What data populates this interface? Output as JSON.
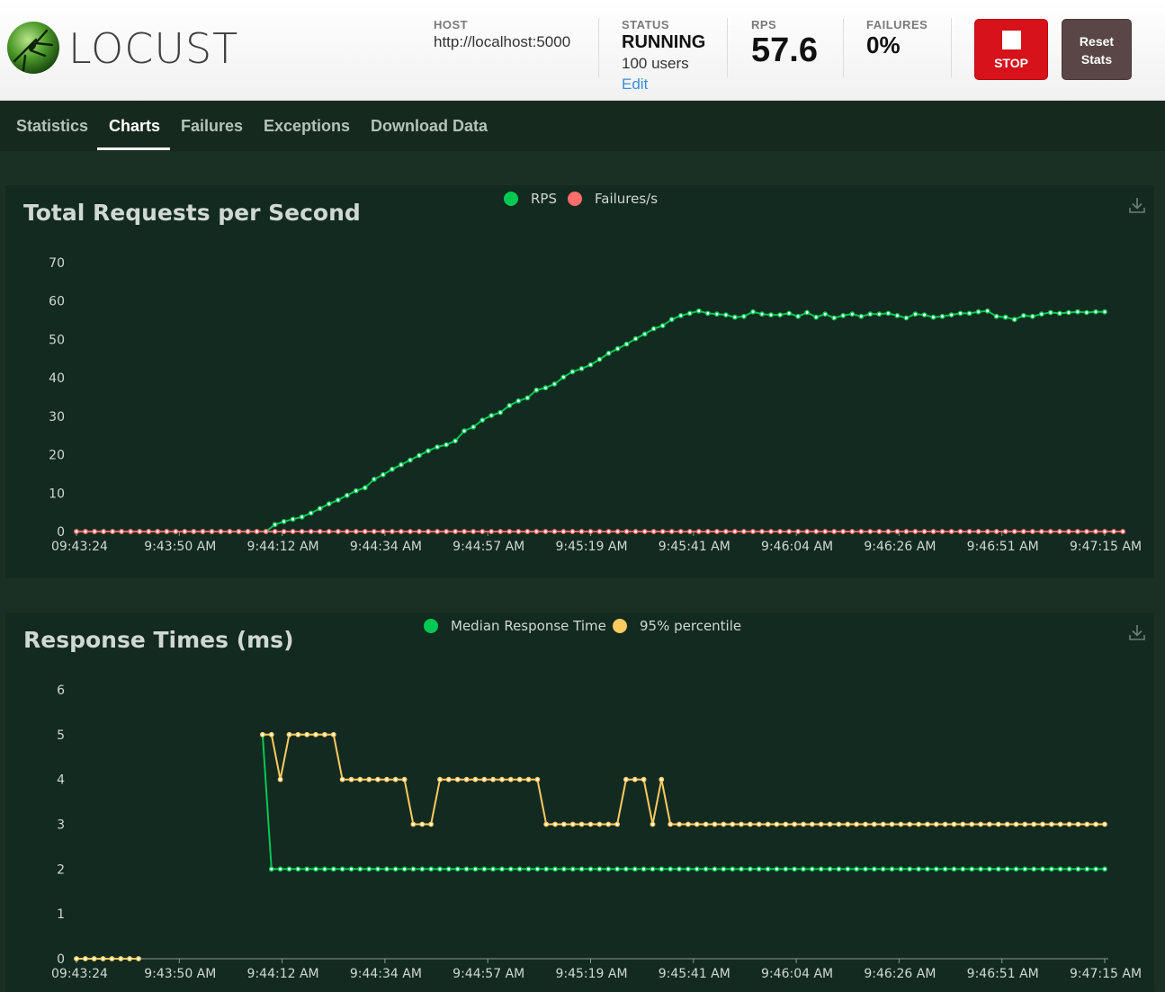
{
  "header": {
    "logo_text": "LOCUST",
    "host_label": "HOST",
    "host_value": "http://localhost:5000",
    "status_label": "STATUS",
    "status_value": "RUNNING",
    "users_value": "100 users",
    "edit_label": "Edit",
    "rps_label": "RPS",
    "rps_value": "57.6",
    "failures_label": "FAILURES",
    "failures_value": "0%",
    "stop_label": "STOP",
    "reset_label": "Reset Stats"
  },
  "tabs": [
    {
      "label": "Statistics",
      "active": false
    },
    {
      "label": "Charts",
      "active": true
    },
    {
      "label": "Failures",
      "active": false
    },
    {
      "label": "Exceptions",
      "active": false
    },
    {
      "label": "Download Data",
      "active": false
    }
  ],
  "colors": {
    "green": "#00c853",
    "red": "#ff6d6d",
    "yellow": "#ffca5f",
    "stop_button": "#d7121a",
    "reset_button": "#5a4647"
  },
  "chart_data": [
    {
      "type": "line",
      "title": "Total Requests per Second",
      "legend": [
        "RPS",
        "Failures/s"
      ],
      "legend_position": "top-center",
      "x_tick_labels": [
        "09:43:24",
        "9:43:50 AM",
        "9:44:12 AM",
        "9:44:34 AM",
        "9:44:57 AM",
        "9:45:19 AM",
        "9:45:41 AM",
        "9:46:04 AM",
        "9:46:26 AM",
        "9:46:51 AM",
        "9:47:15 AM"
      ],
      "ylim": [
        0,
        70
      ],
      "yticks": [
        0,
        10,
        20,
        30,
        40,
        50,
        60,
        70
      ],
      "grid": false,
      "series": [
        {
          "name": "RPS",
          "color": "#00c853",
          "values": [
            0,
            0,
            0,
            0,
            0,
            0,
            0,
            0,
            0,
            0,
            0,
            0,
            0,
            0,
            0,
            0,
            0,
            0,
            0,
            0,
            0,
            0,
            1.8,
            2.6,
            3.2,
            3.8,
            4.8,
            6.0,
            7.2,
            8.2,
            9.4,
            10.6,
            11.4,
            13.6,
            14.8,
            16.2,
            17.4,
            18.6,
            19.8,
            21.0,
            22.0,
            22.6,
            23.6,
            26.2,
            27.2,
            29.0,
            30.2,
            31.0,
            32.8,
            34.0,
            34.8,
            36.8,
            37.4,
            38.4,
            40.2,
            41.6,
            42.4,
            43.4,
            44.8,
            46.4,
            47.6,
            48.8,
            50.2,
            51.4,
            52.8,
            53.6,
            55.2,
            56.2,
            56.8,
            57.4,
            56.8,
            56.6,
            56.4,
            55.8,
            56.0,
            57.2,
            56.6,
            56.4,
            56.4,
            56.8,
            56.0,
            57.0,
            55.8,
            56.6,
            55.6,
            56.2,
            56.6,
            56.0,
            56.6,
            56.6,
            56.8,
            56.2,
            55.6,
            56.6,
            56.4,
            55.8,
            56.0,
            56.4,
            56.8,
            56.8,
            57.2,
            57.4,
            56.0,
            55.8,
            55.2,
            56.2,
            56.0,
            56.6,
            57.0,
            56.8,
            57.0,
            57.2,
            57.0,
            57.2,
            57.2
          ]
        },
        {
          "name": "Failures/s",
          "color": "#ff6d6d",
          "values": [
            0,
            0,
            0,
            0,
            0,
            0,
            0,
            0,
            0,
            0,
            0,
            0,
            0,
            0,
            0,
            0,
            0,
            0,
            0,
            0,
            0,
            0,
            0,
            0,
            0,
            0,
            0,
            0,
            0,
            0,
            0,
            0,
            0,
            0,
            0,
            0,
            0,
            0,
            0,
            0,
            0,
            0,
            0,
            0,
            0,
            0,
            0,
            0,
            0,
            0,
            0,
            0,
            0,
            0,
            0,
            0,
            0,
            0,
            0,
            0,
            0,
            0,
            0,
            0,
            0,
            0,
            0,
            0,
            0,
            0,
            0,
            0,
            0,
            0,
            0,
            0,
            0,
            0,
            0,
            0,
            0,
            0,
            0,
            0,
            0,
            0,
            0,
            0,
            0,
            0,
            0,
            0,
            0,
            0,
            0,
            0,
            0,
            0,
            0,
            0,
            0,
            0,
            0,
            0,
            0,
            0,
            0,
            0,
            0,
            0,
            0,
            0,
            0,
            0,
            0,
            0,
            0
          ]
        }
      ]
    },
    {
      "type": "line",
      "title": "Response Times (ms)",
      "legend": [
        "Median Response Time",
        "95% percentile"
      ],
      "legend_position": "top-center",
      "x_tick_labels": [
        "09:43:24",
        "9:43:50 AM",
        "9:44:12 AM",
        "9:44:34 AM",
        "9:44:57 AM",
        "9:45:19 AM",
        "9:45:41 AM",
        "9:46:04 AM",
        "9:46:26 AM",
        "9:46:51 AM",
        "9:47:15 AM"
      ],
      "ylim": [
        0,
        6
      ],
      "yticks": [
        0,
        1,
        2,
        3,
        4,
        5,
        6
      ],
      "grid": false,
      "series": [
        {
          "name": "Median Response Time",
          "color": "#00c853",
          "values": [
            0,
            0,
            0,
            0,
            0,
            0,
            0,
            0,
            null,
            null,
            null,
            null,
            null,
            null,
            null,
            null,
            null,
            null,
            null,
            null,
            null,
            5,
            2,
            2,
            2,
            2,
            2,
            2,
            2,
            2,
            2,
            2,
            2,
            2,
            2,
            2,
            2,
            2,
            2,
            2,
            2,
            2,
            2,
            2,
            2,
            2,
            2,
            2,
            2,
            2,
            2,
            2,
            2,
            2,
            2,
            2,
            2,
            2,
            2,
            2,
            2,
            2,
            2,
            2,
            2,
            2,
            2,
            2,
            2,
            2,
            2,
            2,
            2,
            2,
            2,
            2,
            2,
            2,
            2,
            2,
            2,
            2,
            2,
            2,
            2,
            2,
            2,
            2,
            2,
            2,
            2,
            2,
            2,
            2,
            2,
            2,
            2,
            2,
            2,
            2,
            2,
            2,
            2,
            2,
            2,
            2,
            2,
            2,
            2,
            2,
            2,
            2,
            2,
            2,
            2,
            2,
            2
          ]
        },
        {
          "name": "95% percentile",
          "color": "#ffca5f",
          "values": [
            0,
            0,
            0,
            0,
            0,
            0,
            0,
            0,
            null,
            null,
            null,
            null,
            null,
            null,
            null,
            null,
            null,
            null,
            null,
            null,
            null,
            5,
            5,
            4,
            5,
            5,
            5,
            5,
            5,
            5,
            4,
            4,
            4,
            4,
            4,
            4,
            4,
            4,
            3,
            3,
            3,
            4,
            4,
            4,
            4,
            4,
            4,
            4,
            4,
            4,
            4,
            4,
            4,
            3,
            3,
            3,
            3,
            3,
            3,
            3,
            3,
            3,
            4,
            4,
            4,
            3,
            4,
            3,
            3,
            3,
            3,
            3,
            3,
            3,
            3,
            3,
            3,
            3,
            3,
            3,
            3,
            3,
            3,
            3,
            3,
            3,
            3,
            3,
            3,
            3,
            3,
            3,
            3,
            3,
            3,
            3,
            3,
            3,
            3,
            3,
            3,
            3,
            3,
            3,
            3,
            3,
            3,
            3,
            3,
            3,
            3,
            3,
            3,
            3,
            3,
            3,
            3
          ]
        }
      ]
    }
  ]
}
